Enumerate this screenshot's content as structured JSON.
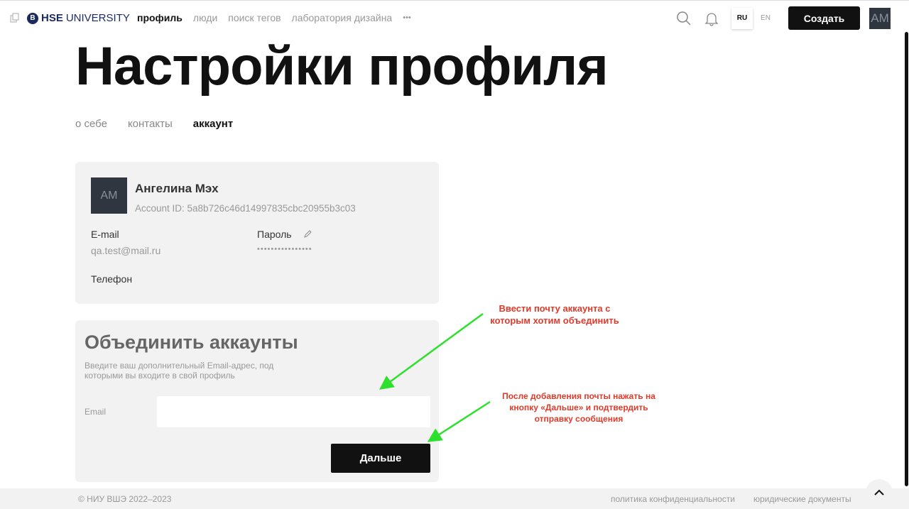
{
  "nav": {
    "logo_bold": "HSE",
    "logo_rest": "UNIVERSITY",
    "logo_badge": "B",
    "items": [
      {
        "label": "профиль",
        "active": true
      },
      {
        "label": "люди"
      },
      {
        "label": "поиск тегов"
      },
      {
        "label": "лаборатория дизайна"
      }
    ],
    "more": "•••",
    "lang_ru": "RU",
    "lang_en": "EN",
    "create": "Создать",
    "avatar": "AM"
  },
  "page": {
    "title": "Настройки профиля",
    "tabs": [
      "о себе",
      "контакты",
      "аккаунт"
    ]
  },
  "account": {
    "avatar": "AM",
    "name": "Ангелина Мэх",
    "account_id": "Account ID: 5a8b726c46d14997835cbc20955b3c03",
    "email_label": "E-mail",
    "email": "qa.test@mail.ru",
    "password_label": "Пароль",
    "password": "••••••••••••••••",
    "phone_label": "Телефон"
  },
  "merge": {
    "title": "Объединить аккаунты",
    "desc": "Введите ваш дополнительный Email-адрес, под которыми вы входите в свой профиль",
    "email_label": "Email",
    "email_value": "",
    "next": "Дальше"
  },
  "notes": {
    "first": "Ввести почту аккаунта с которым хотим объединить",
    "second": "После добавления почты нажать на кнопку «Дальше» и подтвердить отправку сообщения"
  },
  "footer": {
    "copyright": "© НИУ ВШЭ 2022–2023",
    "privacy": "политика конфиденциальности",
    "legal": "юридические документы"
  }
}
